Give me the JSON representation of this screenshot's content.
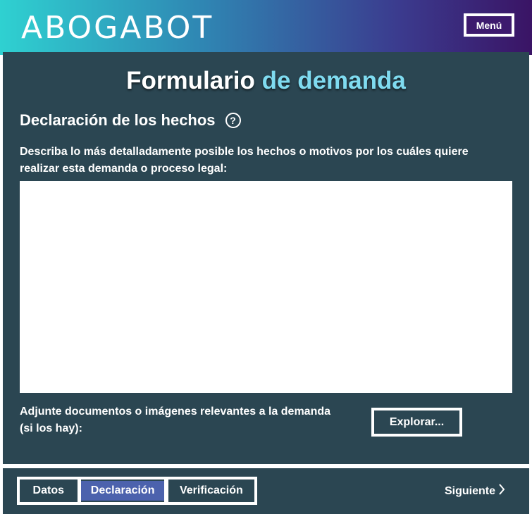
{
  "header": {
    "logo_text": "ABOGABOT",
    "menu_label": "Menú"
  },
  "form": {
    "title_part1": "Formulario",
    "title_part2": "de demanda",
    "section_title": "Declaración de los hechos",
    "help_glyph": "?",
    "description": "Describa lo más detalladamente posible los hechos o motivos por los cuáles quiere realizar esta demanda o proceso legal:",
    "textarea_value": "",
    "attach_label": "Adjunte documentos o imágenes relevantes a la demanda (si los hay):",
    "explore_label": "Explorar..."
  },
  "footer": {
    "steps": [
      {
        "label": "Datos",
        "active": false
      },
      {
        "label": "Declaración",
        "active": true
      },
      {
        "label": "Verificación",
        "active": false
      }
    ],
    "next_label": "Siguiente",
    "next_icon": "chevron-right-icon"
  },
  "colors": {
    "panel": "#2b4652",
    "accent": "#7fdbf0",
    "active_step": "#4c62ad",
    "menu_bg": "#3d1a6e"
  }
}
